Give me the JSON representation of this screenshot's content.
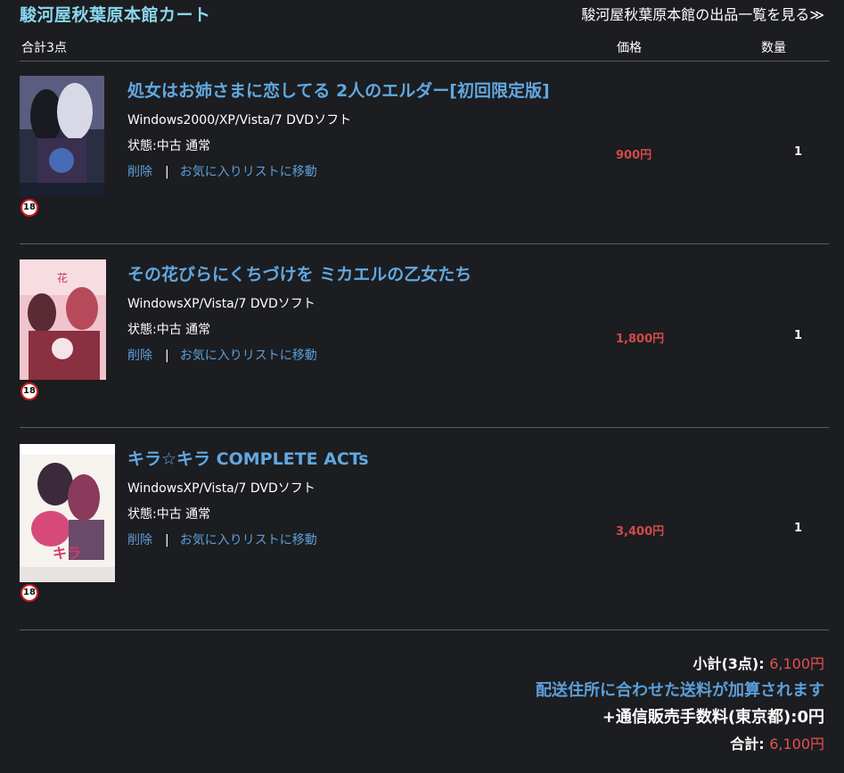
{
  "header": {
    "shop_title": "駿河屋秋葉原本館カート",
    "shop_link": "駿河屋秋葉原本館の出品一覧を見る≫"
  },
  "columns": {
    "total": "合計3点",
    "price": "価格",
    "qty": "数量"
  },
  "items": [
    {
      "title": "処女はお姉さまに恋してる 2人のエルダー[初回限定版]",
      "platform": "Windows2000/XP/Vista/7  DVDソフト",
      "condition": "状態:中古 通常",
      "delete_label": "削除",
      "separator": "|",
      "favorite_label": "お気に入りリストに移動",
      "price": "900円",
      "qty": "1",
      "rating_badge": "18",
      "cover_colors": [
        "#1b2030",
        "#4e4a7a",
        "#c7c3d8"
      ]
    },
    {
      "title": "その花びらにくちづけを ミカエルの乙女たち",
      "platform": "WindowsXP/Vista/7  DVDソフト",
      "condition": "状態:中古 通常",
      "delete_label": "削除",
      "separator": "|",
      "favorite_label": "お気に入りリストに移動",
      "price": "1,800円",
      "qty": "1",
      "rating_badge": "18",
      "cover_colors": [
        "#f2c7cf",
        "#a83a4a",
        "#5a2a35"
      ]
    },
    {
      "title": "キラ☆キラ COMPLETE ACTs",
      "platform": "WindowsXP/Vista/7  DVDソフト",
      "condition": "状態:中古 通常",
      "delete_label": "削除",
      "separator": "|",
      "favorite_label": "お気に入りリストに移動",
      "price": "3,400円",
      "qty": "1",
      "rating_badge": "18",
      "cover_colors": [
        "#f4f1ee",
        "#d64a7a",
        "#3a2a3a"
      ]
    }
  ],
  "summary": {
    "subtotal_label": "小計(3点):",
    "subtotal_value": "6,100円",
    "shipping_note": "配送住所に合わせた送料が加算されます",
    "fee_line": "+通信販売手数料(東京都):0円",
    "total_label": "合計:",
    "total_value": "6,100円"
  },
  "colors": {
    "background": "#1c1d20",
    "title_accent": "#8ad7ee",
    "link_blue": "#5c9ed8",
    "price_red": "#d34a4a"
  }
}
